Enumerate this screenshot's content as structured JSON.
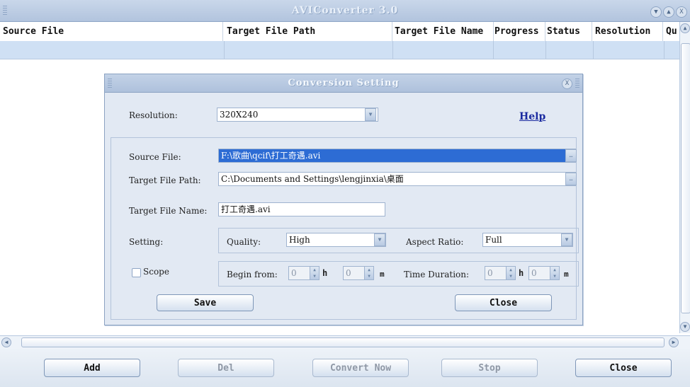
{
  "window": {
    "title": "AVIConverter 3.0",
    "buttons": [
      "▼",
      "▲",
      "X"
    ]
  },
  "table": {
    "columns": [
      "Source File",
      "Target File Path",
      "Target File Name",
      "Progress",
      "Status",
      "Resolution",
      "Qu"
    ],
    "rows": [
      [
        "",
        "",
        "",
        "",
        "",
        "",
        ""
      ]
    ]
  },
  "dialog": {
    "title": "Conversion Setting",
    "resolution_label": "Resolution:",
    "resolution_value": "320X240",
    "help_label": "Help",
    "source_label": "Source File:",
    "source_value": "F:\\歌曲\\qcif\\打工奇遇.avi",
    "target_path_label": "Target File Path:",
    "target_path_value": "C:\\Documents and Settings\\lengjinxia\\桌面",
    "target_name_label": "Target File Name:",
    "target_name_value": "打工奇遇.avi",
    "setting_label": "Setting:",
    "quality_label": "Quality:",
    "quality_value": "High",
    "aspect_label": "Aspect Ratio:",
    "aspect_value": "Full",
    "scope_label": "Scope",
    "scope_checked": false,
    "begin_label": "Begin from:",
    "begin_h": "0",
    "begin_m": "0",
    "h_unit": "h",
    "m_unit": "m",
    "duration_label": "Time Duration:",
    "duration_h": "0",
    "duration_m": "0",
    "save_label": "Save",
    "close_label": "Close"
  },
  "toolbar": {
    "add_label": "Add",
    "del_label": "Del",
    "convert_label": "Convert Now",
    "stop_label": "Stop",
    "close_label": "Close"
  }
}
